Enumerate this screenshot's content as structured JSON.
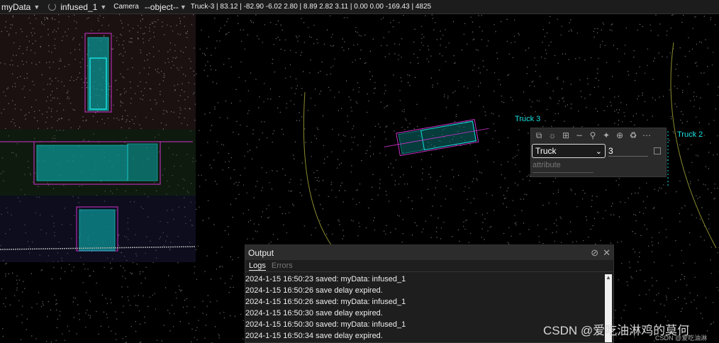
{
  "toolbar": {
    "dataset": "myData",
    "frame": "infused_1",
    "camera": "Camera",
    "object": "--object--",
    "info": "Truck-3 | 83.12 | -82.90 -6.02 2.80 | 8.89 2.82 3.11 | 0.00 0.00 -169.43 | 4825"
  },
  "scene": {
    "labels": [
      "Truck 3",
      "Truck 2"
    ],
    "box_color": "#cc33cc",
    "point_color": "#19e0e0"
  },
  "popup": {
    "category": "Truck",
    "track_id": "3",
    "attribute_placeholder": "attribute",
    "icons": [
      "copy-icon",
      "bulb-icon",
      "layout-icon",
      "curve-icon",
      "zoom-icon",
      "pin-icon",
      "split-icon",
      "trash-icon",
      "more-icon"
    ]
  },
  "output": {
    "title": "Output",
    "tabs": [
      "Logs",
      "Errors"
    ],
    "logs": [
      "2024-1-15 16:50:23 saved: myData: infused_1",
      "2024-1-15 16:50:26 save delay expired.",
      "2024-1-15 16:50:26 saved: myData: infused_1",
      "2024-1-15 16:50:30 save delay expired.",
      "2024-1-15 16:50:30 saved: myData: infused_1",
      "2024-1-15 16:50:34 save delay expired."
    ]
  },
  "watermark": {
    "main": "CSDN @爱吃油淋鸡的莫何",
    "small": "CSDN @爱吃油淋"
  }
}
